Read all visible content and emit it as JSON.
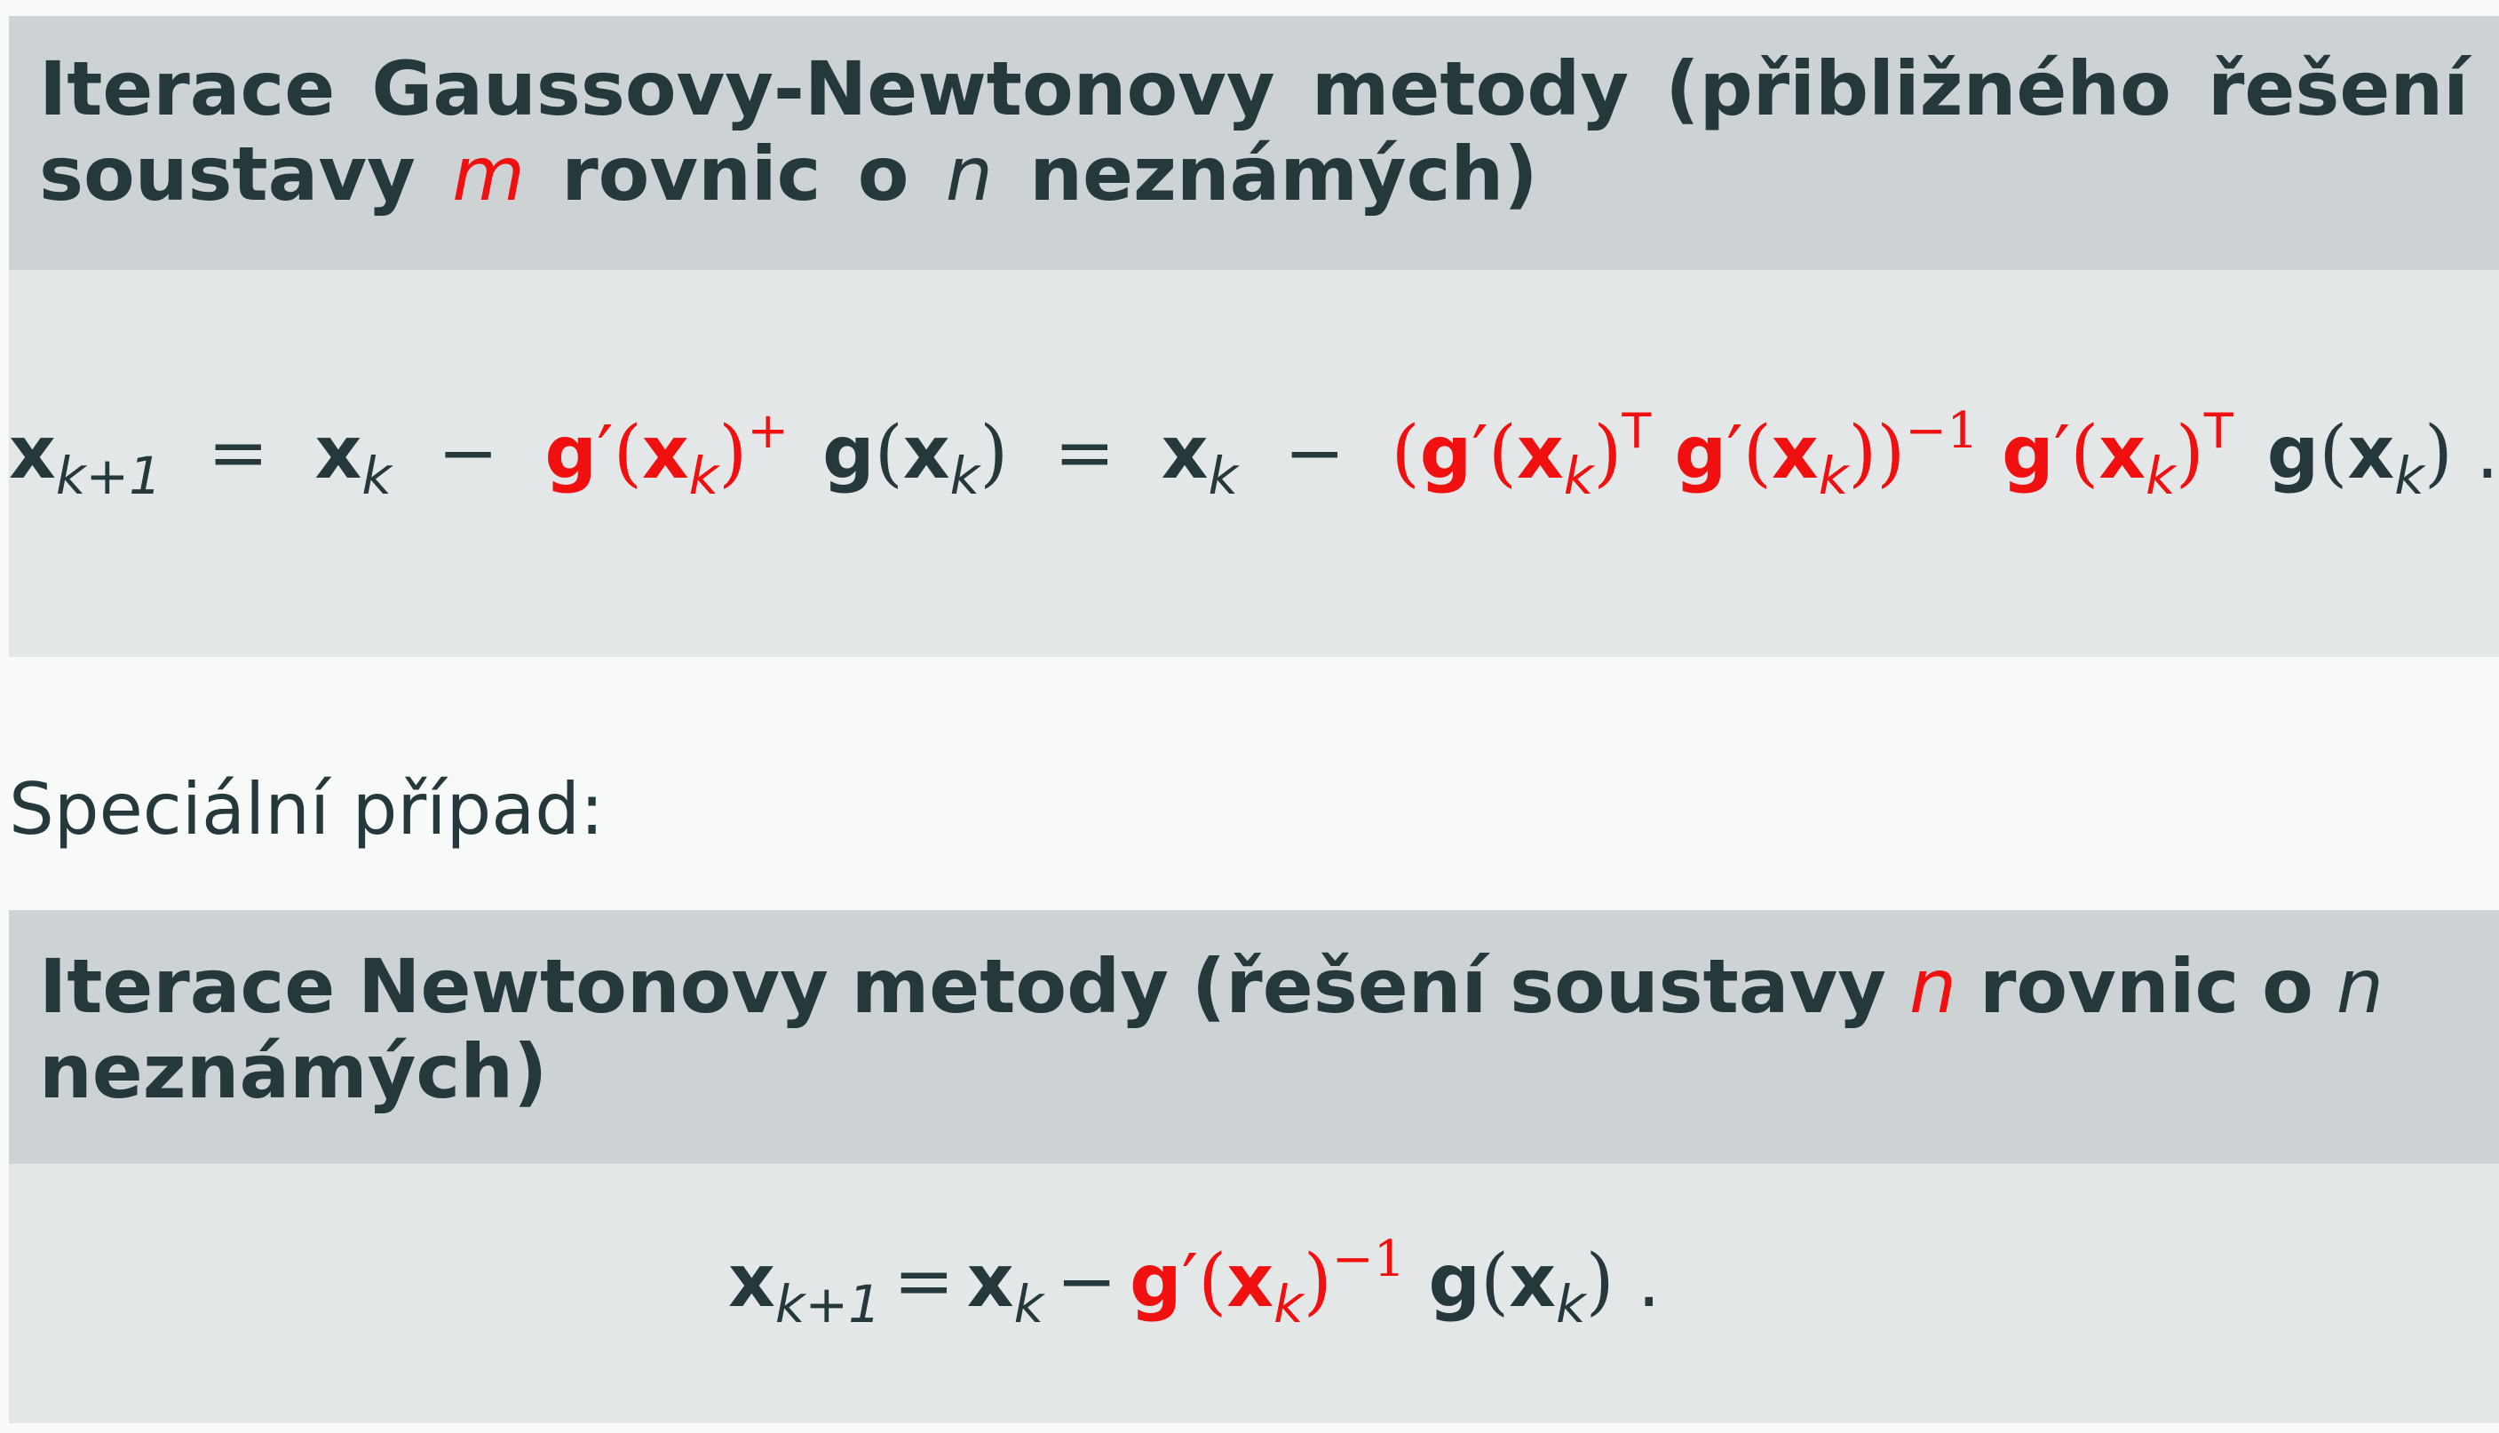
{
  "block1": {
    "title_line1": {
      "words": [
        "Iterace",
        "Gaussovy-Newtonovy",
        "metody",
        "(přibližného",
        "řešení"
      ]
    },
    "title_line2": {
      "w1": "soustavy",
      "var_m": "m",
      "w2": "rovnic",
      "w3": "o",
      "var_n": "n",
      "w4": "neznámých)"
    }
  },
  "formula1": {
    "x": "x",
    "k1": "k+1",
    "k": "k",
    "eq": "=",
    "minus": "−",
    "g": "g",
    "prime": "′",
    "lp": "(",
    "rp": ")",
    "plus_sup": "+",
    "T": "T",
    "inv": "−1",
    "dot": "."
  },
  "special_case": "Speciální případ:",
  "block2": {
    "title_line1": {
      "words": [
        "Iterace",
        "Newtonovy",
        "metody",
        "(řešení",
        "soustavy",
        "n",
        "rovnic",
        "o",
        "n"
      ]
    },
    "title_line2": "neznámých)"
  },
  "colors": {
    "accent": "#f01010",
    "text": "#25383b",
    "title_bg": "#cdd3d4",
    "body_bg": "#e3e7e8",
    "page_bg": "#f8f9f9"
  }
}
